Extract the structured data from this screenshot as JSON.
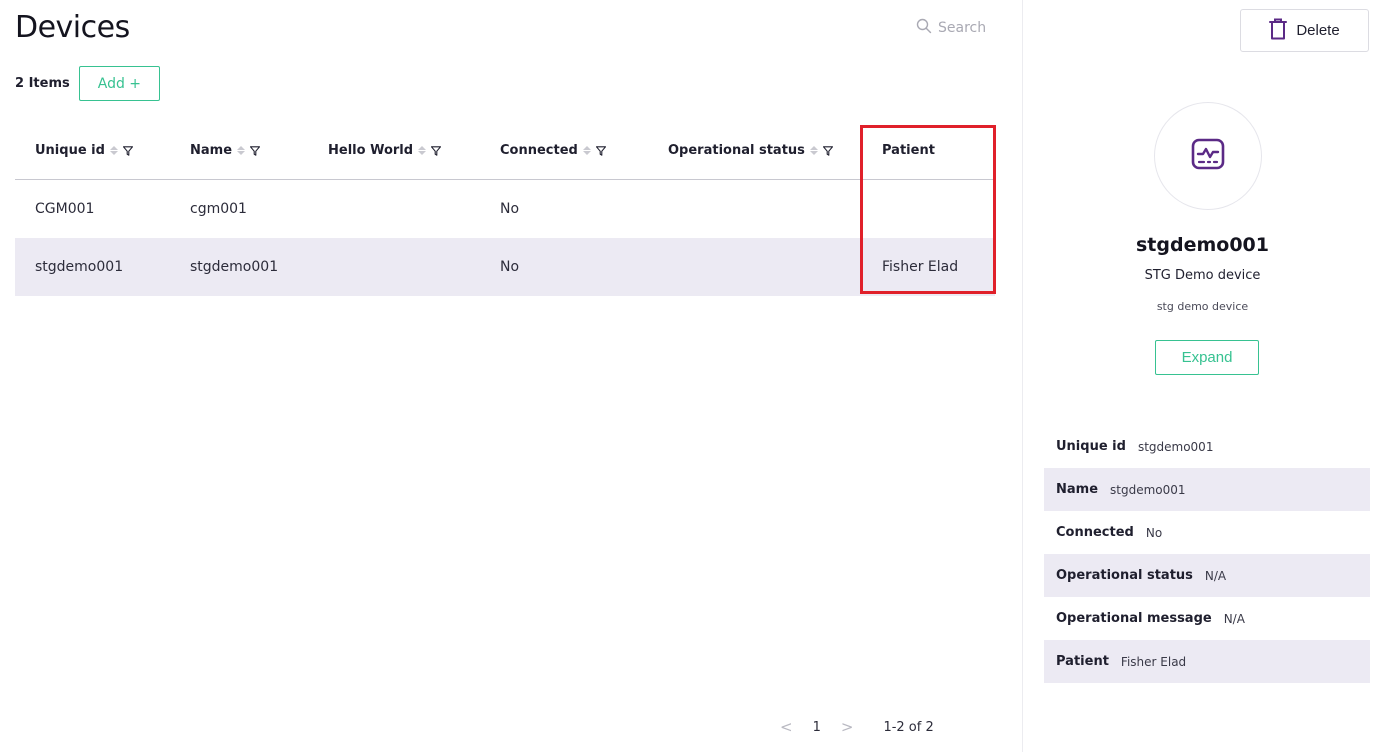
{
  "header": {
    "title": "Devices",
    "search_placeholder": "Search"
  },
  "toolbar": {
    "items_count": "2 Items",
    "add_label": "Add +"
  },
  "table": {
    "columns": [
      {
        "label": "Unique id",
        "sortable": true,
        "filterable": true
      },
      {
        "label": "Name",
        "sortable": true,
        "filterable": true
      },
      {
        "label": "Hello World",
        "sortable": true,
        "filterable": true
      },
      {
        "label": "Connected",
        "sortable": true,
        "filterable": true
      },
      {
        "label": "Operational status",
        "sortable": true,
        "filterable": true
      },
      {
        "label": "Patient",
        "sortable": false,
        "filterable": false
      }
    ],
    "rows": [
      {
        "unique_id": "CGM001",
        "name": "cgm001",
        "hello_world": "",
        "connected": "No",
        "operational_status": "",
        "patient": ""
      },
      {
        "unique_id": "stgdemo001",
        "name": "stgdemo001",
        "hello_world": "",
        "connected": "No",
        "operational_status": "",
        "patient": "Fisher Elad"
      }
    ]
  },
  "pagination": {
    "prev": "<",
    "page": "1",
    "next": ">",
    "range": "1-2 of 2"
  },
  "detail": {
    "delete_label": "Delete",
    "name": "stgdemo001",
    "type": "STG Demo device",
    "description": "stg demo device",
    "expand_label": "Expand",
    "properties": [
      {
        "key": "Unique id",
        "value": "stgdemo001"
      },
      {
        "key": "Name",
        "value": "stgdemo001"
      },
      {
        "key": "Connected",
        "value": "No"
      },
      {
        "key": "Operational status",
        "value": "N/A"
      },
      {
        "key": "Operational message",
        "value": "N/A"
      },
      {
        "key": "Patient",
        "value": "Fisher Elad"
      }
    ]
  },
  "colors": {
    "accent": "#37c291",
    "icon": "#5b2a86",
    "highlight": "#e0202a",
    "row_alt": "#eceaf3"
  }
}
